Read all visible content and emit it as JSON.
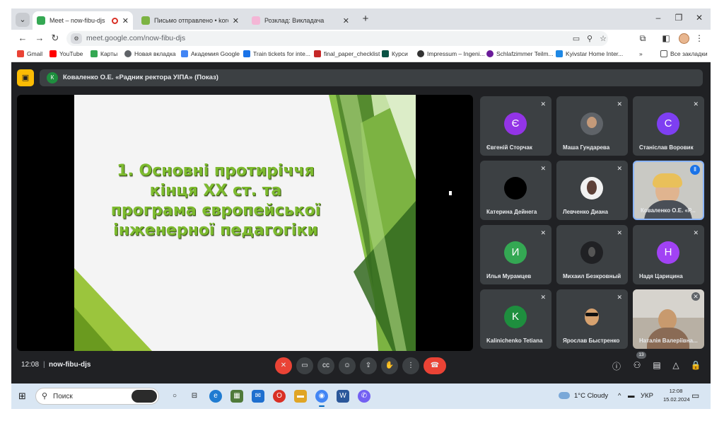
{
  "browser": {
    "tabs": [
      {
        "label": "Meet – now-fibu-djs",
        "active": true,
        "recording": true,
        "favicon_color": "#34a853"
      },
      {
        "label": "Письмо отправлено • korolev",
        "active": false,
        "favicon_color": "#7cb342"
      },
      {
        "label": "Розклад: Викладача",
        "active": false,
        "favicon_color": "#f4b6d6"
      }
    ],
    "url": "meet.google.com/now-fibu-djs",
    "bookmarks": [
      {
        "label": "Gmail",
        "color": "#ea4335"
      },
      {
        "label": "YouTube",
        "color": "#ff0000"
      },
      {
        "label": "Карты",
        "color": "#34a853"
      },
      {
        "label": "Новая вкладка",
        "color": "#5f6368"
      },
      {
        "label": "Академия Google",
        "color": "#4285f4"
      },
      {
        "label": "Train tickets for inte...",
        "color": "#1a73e8"
      },
      {
        "label": "final_paper_checklist",
        "color": "#c62828"
      },
      {
        "label": "Курси",
        "color": "#0b5345"
      },
      {
        "label": "Impressum – Ingeni...",
        "color": "#333333"
      },
      {
        "label": "Schlafzimmer Teilm...",
        "color": "#6a1b9a"
      },
      {
        "label": "Kyivstar Home Inter...",
        "color": "#1e88e5"
      }
    ],
    "bookmarks_more": "»",
    "all_bookmarks": "Все закладки"
  },
  "meet": {
    "presenter_initial": "К",
    "presenting_label": "Коваленко О.Е. «Радник ректора УІПА» (Показ)",
    "slide": {
      "title_lines": [
        "1. Основні протиріччя",
        "кінця XX ст. та",
        "програма європейської",
        "інженерної педагогіки"
      ]
    },
    "participants": [
      {
        "name": "Євгеній Сторчак",
        "initial": "Є",
        "color": "#9334e6",
        "type": "initial"
      },
      {
        "name": "Маша Гундарева",
        "initial": "",
        "color": "#5f6368",
        "type": "photo"
      },
      {
        "name": "Станіслав Воровик",
        "initial": "С",
        "color": "#7e3ff2",
        "type": "initial"
      },
      {
        "name": "Катерина Дейнега",
        "initial": "",
        "color": "#000000",
        "type": "photo"
      },
      {
        "name": "Левченко Диана",
        "initial": "",
        "color": "#ffffff",
        "type": "photo"
      },
      {
        "name": "Коваленко О.Е. «Р...",
        "initial": "",
        "color": "#c9c9c4",
        "type": "speaker"
      },
      {
        "name": "Илья Мурамцев",
        "initial": "И",
        "color": "#34a853",
        "type": "initial"
      },
      {
        "name": "Михаил Безкровный",
        "initial": "",
        "color": "#202124",
        "type": "photo"
      },
      {
        "name": "Надя Царицина",
        "initial": "Н",
        "color": "#a142f4",
        "type": "initial"
      },
      {
        "name": "Kalinichenko Tetiana",
        "initial": "K",
        "color": "#1e8e3e",
        "type": "initial"
      },
      {
        "name": "Ярослав Быстренко",
        "initial": "",
        "color": "#3c4043",
        "type": "photo"
      },
      {
        "name": "Наталія Валеріївна...",
        "initial": "",
        "color": "#b8b0a4",
        "type": "video"
      }
    ],
    "time": "12:08",
    "separator": "|",
    "meeting_code": "now-fibu-djs",
    "participant_count": "13"
  },
  "taskbar": {
    "search_placeholder": "Поиск",
    "weather": "1°C Cloudy",
    "language": "УКР",
    "time": "12:08",
    "date": "15.02.2024"
  }
}
